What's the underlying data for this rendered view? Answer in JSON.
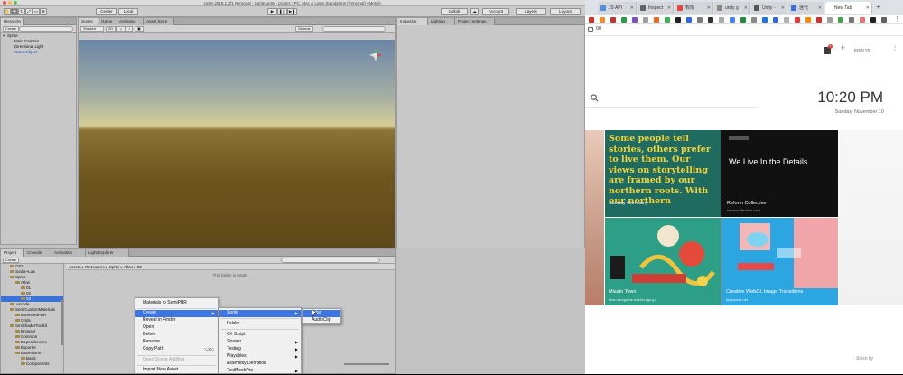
{
  "unity": {
    "title": "Unity 2018.1.0f1 Personal - Sprite.unity - project - PC, Mac & Linux Standalone [Personal] <Metal>",
    "toolbar": {
      "pivot": "Center",
      "space": "Local",
      "collab": "Collab",
      "account": "Account",
      "layers": "Layers",
      "layout": "Layout"
    },
    "hierarchy": {
      "tab": "Hierarchy",
      "create": "Create",
      "items": [
        "Sprite",
        "Main Camera",
        "Directional Light",
        "GameObject"
      ]
    },
    "scene": {
      "tabs": [
        "Scene",
        "Game",
        "Animator",
        "Asset Store"
      ],
      "shading": "Shaded",
      "mode": "2D",
      "gizmos": "Gizmos"
    },
    "inspector": {
      "tabs": [
        "Inspector",
        "Lighting",
        "Project Settings"
      ]
    },
    "project": {
      "tabs": [
        "Project",
        "Console",
        "Animation",
        "Light Explorer"
      ],
      "create": "Create",
      "breadcrumb": [
        "Assets",
        "Resources",
        "Sprite",
        "Atlas",
        "03"
      ],
      "empty_message": "This folder is empty",
      "tree": [
        "OSS",
        "Sodia~Lua",
        "Sprite",
        "Atlas",
        "01",
        "02",
        "03",
        ".vscode",
        "SemiCustomMaterials",
        "ExtendedPBR",
        "Grids",
        "SmiShaderToolkit",
        "Browser",
        "Common",
        "Dependencies",
        "Exporter",
        "Extensions",
        "Basic",
        "Components"
      ]
    },
    "context_menu": {
      "items": [
        {
          "label": "Materials to SemiPBR"
        },
        {
          "label": "Create",
          "submenu": true
        },
        {
          "label": "Reveal in Finder"
        },
        {
          "label": "Open"
        },
        {
          "label": "Delete"
        },
        {
          "label": "Rename"
        },
        {
          "label": "Copy Path",
          "shortcut": "⌥⌘C"
        },
        {
          "label": "Open Scene Additive"
        },
        {
          "label": "Import New Asset..."
        }
      ]
    },
    "create_menu": {
      "items": [
        {
          "label": "Sprite",
          "submenu": true
        },
        {
          "label": "Folder"
        },
        {
          "label": "C# Script"
        },
        {
          "label": "Shader",
          "submenu": true
        },
        {
          "label": "Testing",
          "submenu": true
        },
        {
          "label": "Playables",
          "submenu": true
        },
        {
          "label": "Assembly Definition"
        },
        {
          "label": "TextMeshPro",
          "submenu": true
        }
      ]
    },
    "sprite_menu": {
      "items": [
        {
          "label": "Atlas"
        },
        {
          "label": "AudioClip"
        }
      ]
    }
  },
  "chrome": {
    "tabs": [
      {
        "label": "JS API",
        "color": "#4a8fe7"
      },
      {
        "label": "Inspect",
        "color": "#5f6368"
      },
      {
        "label": "权限",
        "color": "#e8453c"
      },
      {
        "label": "unity g",
        "color": "#888888"
      },
      {
        "label": "Unity -",
        "color": "#555555"
      },
      {
        "label": "迷代",
        "color": "#3b6fd8"
      },
      {
        "label": "New Tab",
        "color": "#999999"
      }
    ],
    "bookmarks": "00",
    "ntp": {
      "clock": "10:20 PM",
      "date": "Sunday, November 10",
      "badge": "1",
      "user_label": "ERIN YE",
      "credit": "Stock by"
    },
    "cards": [
      {
        "headline": "Some people tell stories, others prefer to live them. Our views on storytelling are framed by our northern roots. With our northern",
        "title": "Sunday Company",
        "url": ""
      },
      {
        "headline": "We Live In the Details.",
        "title": "Reform Collective",
        "url": "reformcollective.com"
      },
      {
        "headline": "",
        "title": "Misato Town",
        "url": "town.zkmgame.misato.kgo.jp"
      },
      {
        "headline": "",
        "title": "Creative WebGL Image Transitions",
        "url": "tympanus.net"
      }
    ]
  }
}
